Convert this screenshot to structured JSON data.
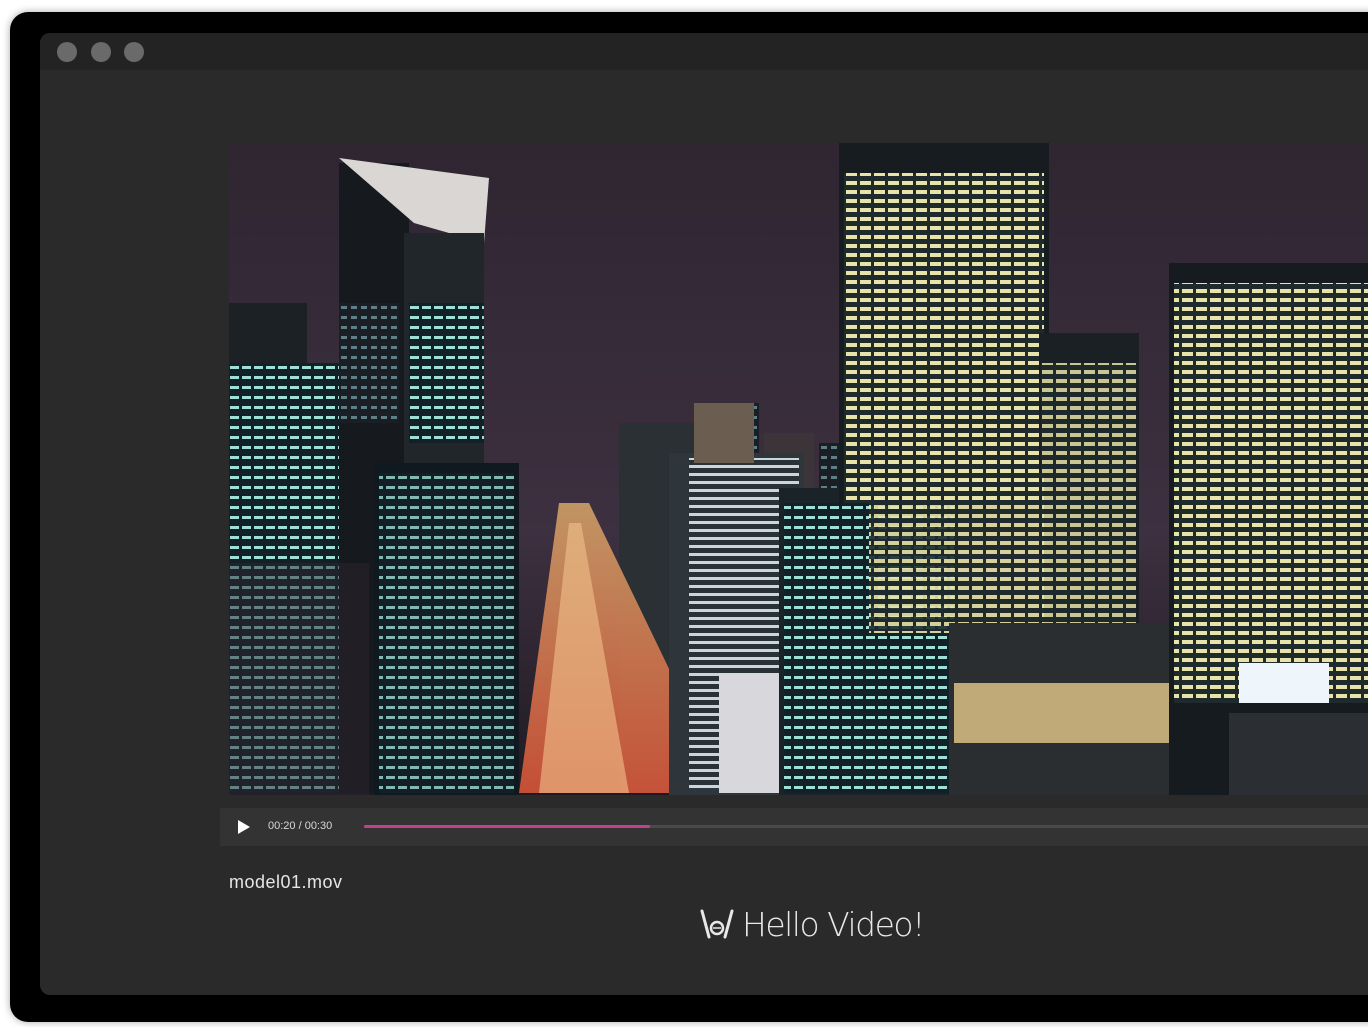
{
  "window": {
    "controls": [
      "close",
      "minimize",
      "zoom"
    ]
  },
  "video": {
    "thumbnail": "night-city-skyline",
    "time_display": "00:20 / 00:30",
    "progress": 0.283,
    "accent_color": "#c2418f",
    "play_icon": "play-icon"
  },
  "file": {
    "name": "model01.mov"
  },
  "brand": {
    "logo": "hello-video-logo",
    "text": "Hello Video!"
  }
}
